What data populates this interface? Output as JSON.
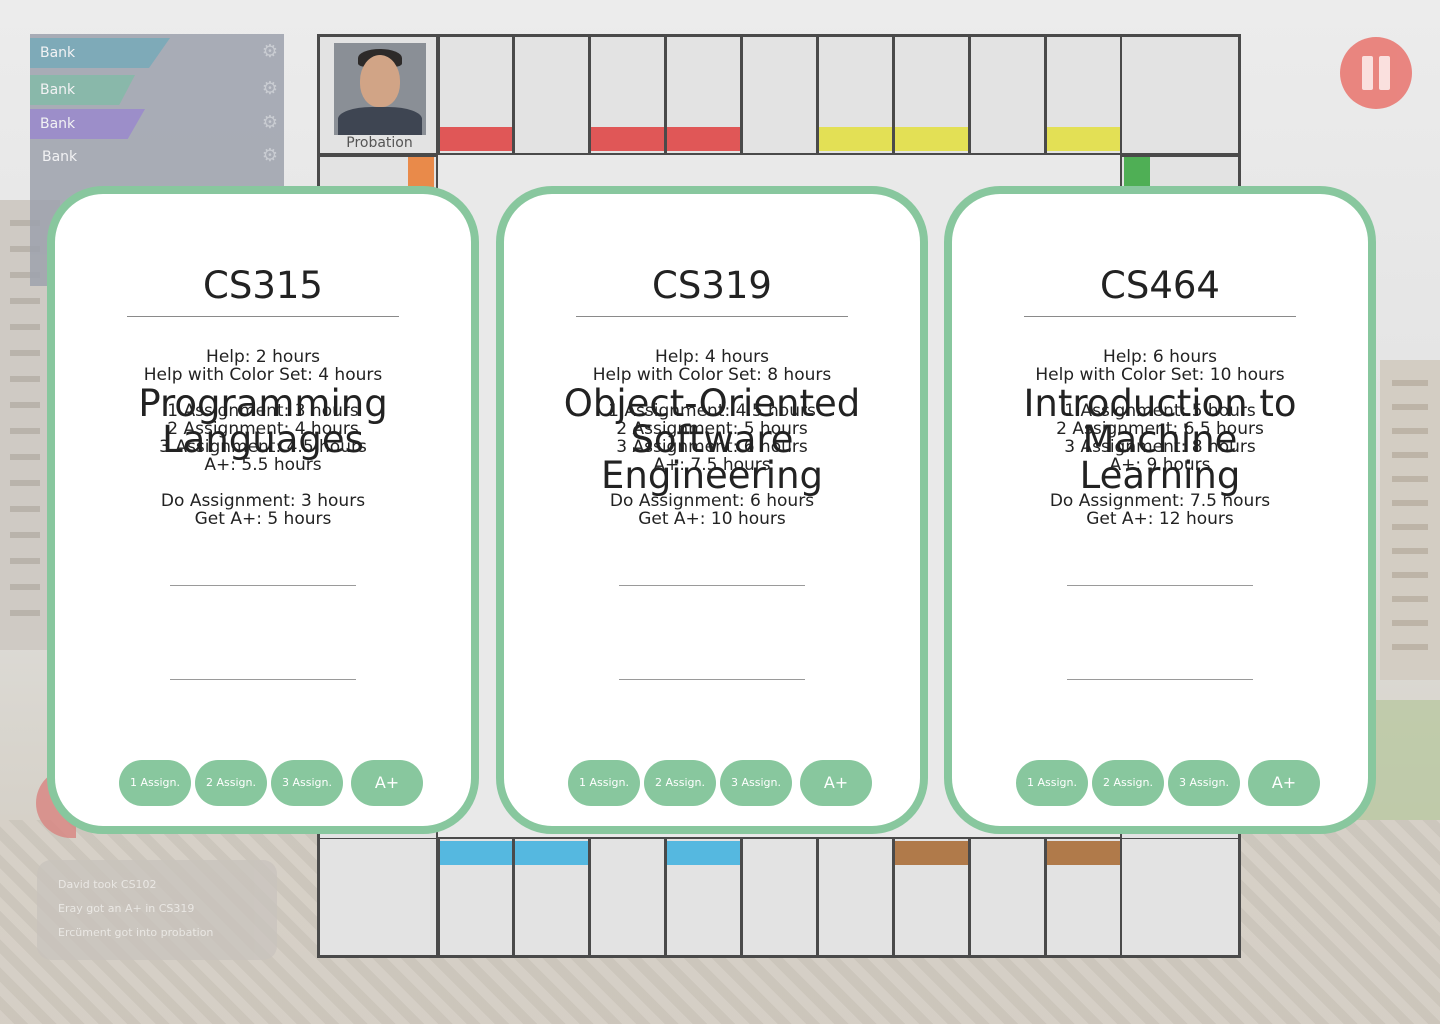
{
  "players": [
    {
      "label": "Bank",
      "color": "#6b9fb0"
    },
    {
      "label": "Bank",
      "color": "#79b09f"
    },
    {
      "label": "Bank",
      "color": "#8f7fc4"
    },
    {
      "label": "Bank",
      "color": "#8a8f9b"
    }
  ],
  "board": {
    "corner_label": "Probation",
    "top_band_colors": [
      "",
      "#e05757",
      "",
      "#e05757",
      "#e05757",
      "",
      "#e3e055",
      "#e3e055",
      "",
      "#e3e055",
      ""
    ],
    "bottom_band_colors": [
      "",
      "#55b8e0",
      "#55b8e0",
      "",
      "#55b8e0",
      "",
      "",
      "#b07a4a",
      "",
      "#b07a4a",
      ""
    ],
    "left_accent": "#e98a4a",
    "right_accent": "#4faf55"
  },
  "log": [
    "David took CS102",
    "Eray got an A+ in CS319",
    "Ercüment got into probation"
  ],
  "cards": [
    {
      "code": "CS315",
      "name": [
        "Programming",
        "Languages"
      ],
      "help": "Help: 2 hours",
      "help_set": "Help with Color Set: 4 hours",
      "a1": "1 Assignment: 3 hours",
      "a2": "2 Assignment: 4 hours",
      "a3": "3 Assignment: 4.5 hours",
      "aplus": "A+: 5.5 hours",
      "do": "Do Assignment: 3 hours",
      "get": "Get A+: 5 hours",
      "buttons": [
        "1 Assign.",
        "2 Assign.",
        "3 Assign.",
        "A+"
      ]
    },
    {
      "code": "CS319",
      "name": [
        "Object-Oriented",
        "Software",
        "Engineering"
      ],
      "help": "Help: 4 hours",
      "help_set": "Help with Color Set: 8 hours",
      "a1": "1 Assignment: 4.5 hours",
      "a2": "2 Assignment: 5 hours",
      "a3": "3 Assignment: 6 hours",
      "aplus": "A+: 7.5 hours",
      "do": "Do Assignment: 6 hours",
      "get": "Get A+: 10 hours",
      "buttons": [
        "1 Assign.",
        "2 Assign.",
        "3 Assign.",
        "A+"
      ]
    },
    {
      "code": "CS464",
      "name": [
        "Introduction to",
        "Machine",
        "Learning"
      ],
      "help": "Help: 6 hours",
      "help_set": "Help with Color Set: 10 hours",
      "a1": "1 Assignment: 5 hours",
      "a2": "2 Assignment: 6.5 hours",
      "a3": "3 Assignment: 8 hours",
      "aplus": "A+: 9 hours",
      "do": "Do Assignment: 7.5 hours",
      "get": "Get A+: 12 hours",
      "buttons": [
        "1 Assign.",
        "2 Assign.",
        "3 Assign.",
        "A+"
      ]
    }
  ]
}
